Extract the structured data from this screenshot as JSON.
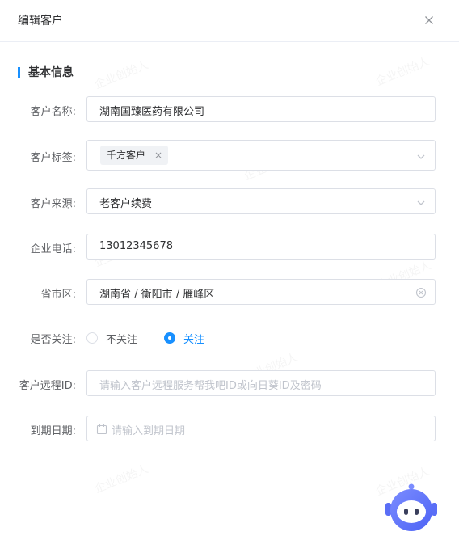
{
  "dialog": {
    "title": "编辑客户",
    "close_icon": "close-icon"
  },
  "section": {
    "title": "基本信息",
    "accent": "#1890ff"
  },
  "form": {
    "name": {
      "label": "客户名称:",
      "value": "湖南国臻医药有限公司"
    },
    "tags": {
      "label": "客户标签:",
      "tag": "千方客户",
      "tag_close": "×"
    },
    "source": {
      "label": "客户来源:",
      "value": "老客户续费"
    },
    "phone": {
      "label": "企业电话:",
      "value": "13012345678"
    },
    "region": {
      "label": "省市区:",
      "value": "湖南省 / 衡阳市 / 雁峰区"
    },
    "follow": {
      "label": "是否关注:",
      "options": [
        "不关注",
        "关注"
      ],
      "selected": "关注"
    },
    "remote_id": {
      "label": "客户远程ID:",
      "placeholder": "请输入客户远程服务帮我吧ID或向日葵ID及密码"
    },
    "expire": {
      "label": "到期日期:",
      "placeholder": "请输入到期日期"
    }
  },
  "watermark": "企业创始人",
  "colors": {
    "primary": "#1890ff",
    "border": "#dcdfe6",
    "placeholder": "#c0c4cc"
  }
}
